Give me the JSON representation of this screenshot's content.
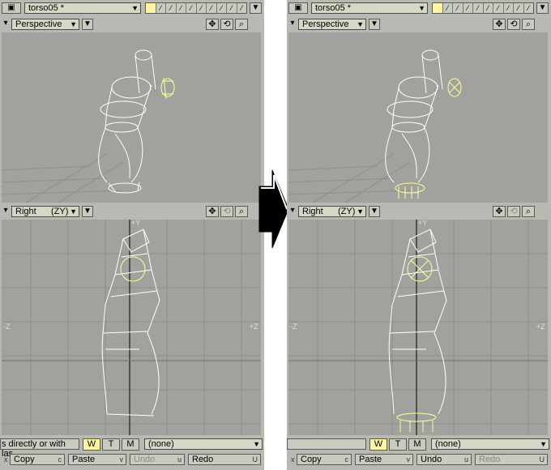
{
  "before": {
    "object_name": "torso05 *",
    "top_viewport": {
      "view": "Perspective"
    },
    "bottom_viewport": {
      "view": "Right",
      "axis": "(ZY)",
      "labels": {
        "y": "+Y",
        "neg_z": "-Z",
        "pos_z": "+Z"
      }
    },
    "status_text": "s directly or with las...",
    "modes": [
      "W",
      "T",
      "M"
    ],
    "active_mode": "W",
    "selection_set": "(none)",
    "commands": [
      {
        "prefix": "x",
        "label": "Copy",
        "key": "c"
      },
      {
        "prefix": "",
        "label": "Paste",
        "key": "v"
      },
      {
        "prefix": "",
        "label": "Undo",
        "key": "u",
        "disabled": true
      },
      {
        "prefix": "",
        "label": "Redo",
        "key": "U"
      }
    ]
  },
  "after": {
    "object_name": "torso05 *",
    "top_viewport": {
      "view": "Perspective"
    },
    "bottom_viewport": {
      "view": "Right",
      "axis": "(ZY)",
      "labels": {
        "y": "+Y",
        "neg_z": "-Z",
        "pos_z": "+Z"
      }
    },
    "status_text": "",
    "modes": [
      "W",
      "T",
      "M"
    ],
    "active_mode": "W",
    "selection_set": "(none)",
    "commands": [
      {
        "prefix": "x",
        "label": "Copy",
        "key": "c"
      },
      {
        "prefix": "c",
        "label": "Paste",
        "key": "v"
      },
      {
        "prefix": "v",
        "label": "Undo",
        "key": "u"
      },
      {
        "prefix": "u",
        "label": "Redo",
        "key": "U",
        "disabled": true
      }
    ]
  },
  "colors": {
    "viewport": "#a1a29d",
    "panel": "#b8b9b3",
    "wire": "#ffffff",
    "selected": "#ffff99",
    "grid": "#8d8e89"
  },
  "icons": [
    "move-view-icon",
    "rotate-view-icon",
    "zoom-view-icon",
    "layer-swatch-icon",
    "dropdown-arrow-icon",
    "transition-arrow-icon"
  ]
}
